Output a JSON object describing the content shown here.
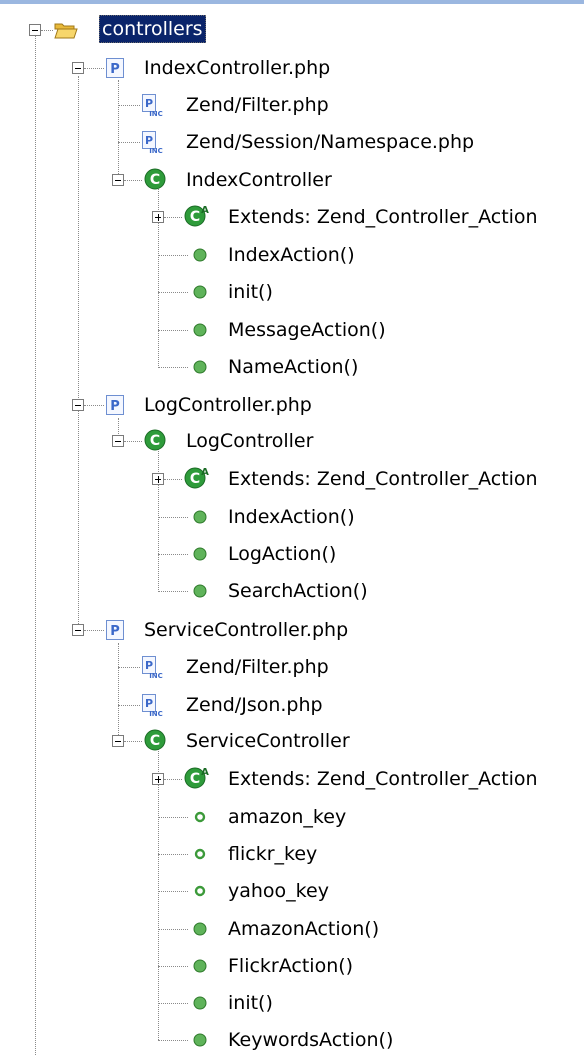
{
  "tree": {
    "root": {
      "label": "controllers",
      "icon": "folder-open-icon"
    },
    "rows": [
      {
        "label": "IndexController.php",
        "icon": "php-file-icon"
      },
      {
        "label": "Zend/Filter.php",
        "icon": "php-include-icon"
      },
      {
        "label": "Zend/Session/Namespace.php",
        "icon": "php-include-icon"
      },
      {
        "label": "IndexController",
        "icon": "class-icon"
      },
      {
        "label": "Extends: Zend_Controller_Action",
        "icon": "abstract-class-icon"
      },
      {
        "label": "IndexAction()",
        "icon": "public-method-icon"
      },
      {
        "label": "init()",
        "icon": "public-method-icon"
      },
      {
        "label": "MessageAction()",
        "icon": "public-method-icon"
      },
      {
        "label": "NameAction()",
        "icon": "public-method-icon"
      },
      {
        "label": "LogController.php",
        "icon": "php-file-icon"
      },
      {
        "label": "LogController",
        "icon": "class-icon"
      },
      {
        "label": "Extends: Zend_Controller_Action",
        "icon": "abstract-class-icon"
      },
      {
        "label": "IndexAction()",
        "icon": "public-method-icon"
      },
      {
        "label": "LogAction()",
        "icon": "public-method-icon"
      },
      {
        "label": "SearchAction()",
        "icon": "public-method-icon"
      },
      {
        "label": "ServiceController.php",
        "icon": "php-file-icon"
      },
      {
        "label": "Zend/Filter.php",
        "icon": "php-include-icon"
      },
      {
        "label": "Zend/Json.php",
        "icon": "php-include-icon"
      },
      {
        "label": "ServiceController",
        "icon": "class-icon"
      },
      {
        "label": "Extends: Zend_Controller_Action",
        "icon": "abstract-class-icon"
      },
      {
        "label": "amazon_key",
        "icon": "public-field-icon"
      },
      {
        "label": "flickr_key",
        "icon": "public-field-icon"
      },
      {
        "label": "yahoo_key",
        "icon": "public-field-icon"
      },
      {
        "label": "AmazonAction()",
        "icon": "public-method-icon"
      },
      {
        "label": "FlickrAction()",
        "icon": "public-method-icon"
      },
      {
        "label": "init()",
        "icon": "public-method-icon"
      },
      {
        "label": "KeywordsAction()",
        "icon": "public-method-icon"
      }
    ]
  },
  "colors": {
    "selection_bg": "#0a246a",
    "method_green": "#4caf50",
    "class_green": "#2e9b3a",
    "php_blue": "#3b68c9",
    "folder_yellow": "#f2c94c"
  }
}
